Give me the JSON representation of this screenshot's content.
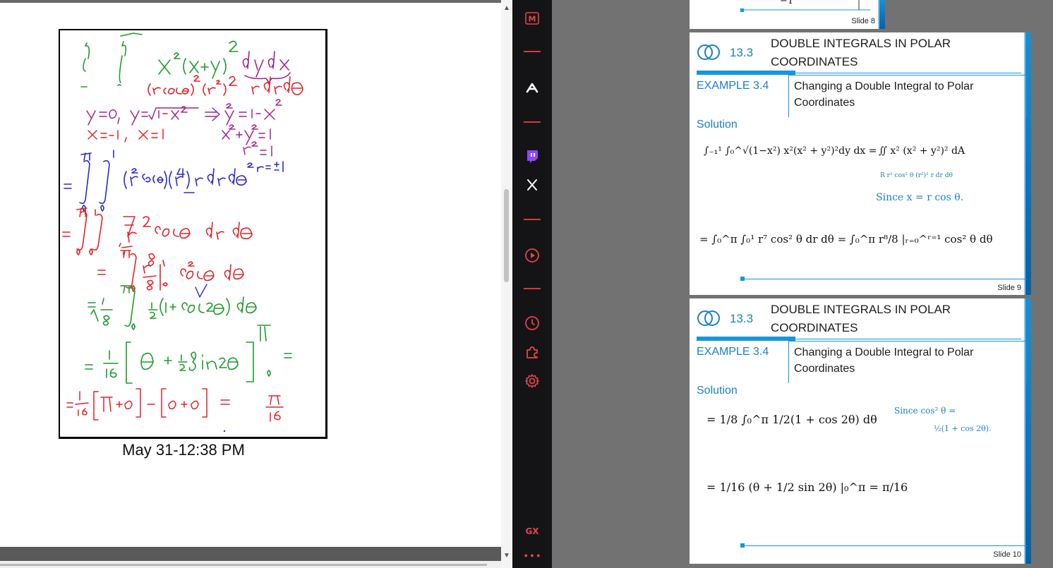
{
  "note": {
    "timestamp": "May 31-12:38 PM"
  },
  "toolbar": {
    "items": [
      {
        "icon": "gmail-m-icon",
        "label": "M"
      },
      {
        "icon": "arc-a-icon",
        "label": ""
      },
      {
        "icon": "twitch-icon",
        "label": ""
      },
      {
        "icon": "x-twitter-icon",
        "label": "𝕏"
      },
      {
        "icon": "play-circle-icon",
        "label": ""
      },
      {
        "icon": "clock-icon",
        "label": ""
      },
      {
        "icon": "puzzle-icon",
        "label": ""
      },
      {
        "icon": "settings-gear-icon",
        "label": ""
      }
    ],
    "gx_label": "GX",
    "more_label": "⋮"
  },
  "slides": [
    {
      "number": "Slide 8",
      "axis_label": "−1",
      "axis_value": "1"
    },
    {
      "number": "Slide 9",
      "section": "13.3",
      "title_line1": "DOUBLE INTEGRALS IN POLAR",
      "title_line2": "COORDINATES",
      "example": "EXAMPLE 3.4",
      "example_title_line1": "Changing a Double Integral to Polar",
      "example_title_line2": "Coordinates",
      "solution": "Solution",
      "eq1_lhs": "∫₋₁¹ ∫₀^√(1−x²) x²(x² + y²)²dy dx =",
      "eq1_rhs": "∬ x² (x² + y²)² dA",
      "eq1_sub": "R   r² cos² θ   (r²)²   r dr dθ",
      "note": "Since x = r cos θ.",
      "eq2": "= ∫₀^π ∫₀¹ r⁷ cos² θ dr dθ   = ∫₀^π r⁸/8 |ᵣ₌₀^ʳ⁼¹ cos² θ dθ"
    },
    {
      "number": "Slide 10",
      "section": "13.3",
      "title_line1": "DOUBLE INTEGRALS IN POLAR",
      "title_line2": "COORDINATES",
      "example": "EXAMPLE 3.4",
      "example_title_line1": "Changing a Double Integral to Polar",
      "example_title_line2": "Coordinates",
      "solution": "Solution",
      "eq1": "= 1/8 ∫₀^π 1/2(1 + cos 2θ) dθ",
      "note_line1": "Since cos² θ =",
      "note_line2": "½(1 + cos 2θ).",
      "eq2": "= 1/16 (θ + 1/2 sin 2θ) |₀^π = π/16"
    }
  ],
  "colors": {
    "ink_green": "#1f9a2a",
    "ink_red": "#e0242a",
    "ink_blue": "#2a2ad0",
    "ink_purple": "#a0248a",
    "accent_blue": "#1597d8"
  }
}
